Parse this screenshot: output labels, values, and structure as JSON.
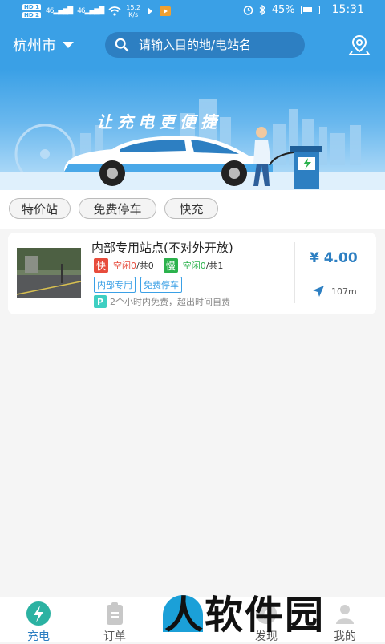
{
  "status_bar": {
    "hd1": "HD 1",
    "hd2": "HD 2",
    "signal1": "46",
    "signal2": "46",
    "speed_value": "15.2",
    "speed_unit": "K/s",
    "battery": "45%",
    "time": "15:31"
  },
  "header": {
    "city": "杭州市",
    "search_placeholder": "请输入目的地/电站名"
  },
  "banner": {
    "slogan": "让充电更便捷"
  },
  "filters": [
    "特价站",
    "免费停车",
    "快充"
  ],
  "station": {
    "name": "内部专用站点(不对外开放)",
    "fast_label": "快",
    "fast_free_text": "空闲0",
    "fast_total_text": "/共0",
    "slow_label": "慢",
    "slow_free_text": "空闲0",
    "slow_total_text": "/共1",
    "tags": [
      "内部专用",
      "免费停车"
    ],
    "parking_icon": "P",
    "parking_note": "2个小时内免费，超出时间自费",
    "price": "¥ 4.00",
    "distance": "107m"
  },
  "nav": {
    "items": [
      {
        "label": "充电",
        "icon": "bolt-icon",
        "active": true
      },
      {
        "label": "订单",
        "icon": "order-icon"
      },
      {
        "label": "发现",
        "icon": "discover-icon"
      },
      {
        "label": "我的",
        "icon": "profile-icon"
      }
    ]
  },
  "watermark": "人软件园",
  "colors": {
    "primary": "#3aa0e6",
    "price": "#2d7fc2",
    "fast": "#e74c3c",
    "slow": "#2bb24c"
  }
}
